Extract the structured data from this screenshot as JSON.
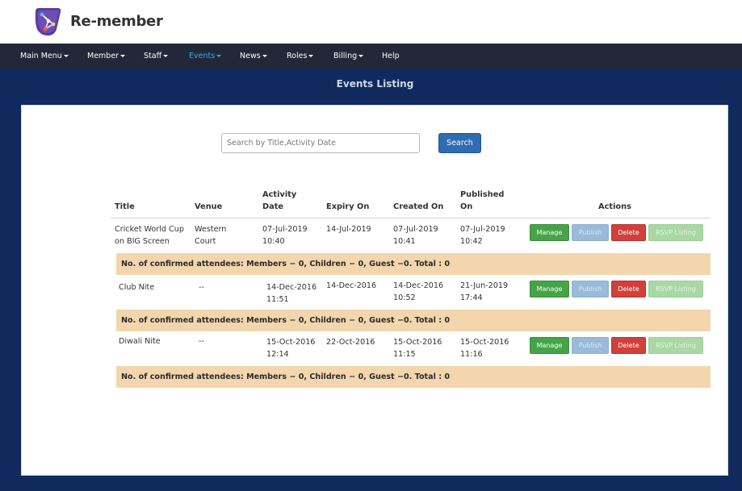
{
  "app": {
    "name": "Re-member",
    "logo_icon": "app-logo-icon"
  },
  "nav": {
    "items": [
      {
        "label": "Main Menu",
        "dropdown": true
      },
      {
        "label": "Member",
        "dropdown": true
      },
      {
        "label": "Staff",
        "dropdown": true
      },
      {
        "label": "Events",
        "dropdown": true,
        "active": true
      },
      {
        "label": "News",
        "dropdown": true
      },
      {
        "label": "Roles",
        "dropdown": true
      },
      {
        "label": "Billing",
        "dropdown": true
      },
      {
        "label": "Help",
        "dropdown": false
      }
    ]
  },
  "page": {
    "title": "Events Listing"
  },
  "search": {
    "placeholder": "Search by Title,Activity Date",
    "value": "",
    "button_label": "Search"
  },
  "table": {
    "headers": {
      "title": "Title",
      "venue": "Venue",
      "activity_date_l1": "Activity",
      "activity_date_l2": "Date",
      "expiry_on": "Expiry On",
      "created_on": "Created On",
      "published_on_l1": "Published",
      "published_on_l2": "On",
      "actions": "Actions"
    },
    "rows": [
      {
        "title_l1": "Cricket World Cup",
        "title_l2": "on BIG Screen",
        "venue_l1": "Western",
        "venue_l2": "Court",
        "activity_date_l1": "07-Jul-2019",
        "activity_date_l2": "10:40",
        "expiry_on": "14-Jul-2019",
        "created_on_l1": "07-Jul-2019",
        "created_on_l2": "10:41",
        "published_on_l1": "07-Jul-2019",
        "published_on_l2": "10:42",
        "summary": "No. of confirmed attendees: Members − 0, Children − 0, Guest −0. Total : 0"
      },
      {
        "title_l1": "Club Nite",
        "title_l2": "",
        "venue_l1": "--",
        "venue_l2": "",
        "activity_date_l1": "14-Dec-2016",
        "activity_date_l2": "11:51",
        "expiry_on": "14-Dec-2016",
        "created_on_l1": "14-Dec-2016",
        "created_on_l2": "10:52",
        "published_on_l1": "21-Jun-2019",
        "published_on_l2": "17:44",
        "summary": "No. of confirmed attendees: Members − 0, Children − 0, Guest −0. Total : 0"
      },
      {
        "title_l1": "Diwali Nite",
        "title_l2": "",
        "venue_l1": "--",
        "venue_l2": "",
        "activity_date_l1": "15-Oct-2016",
        "activity_date_l2": "12:14",
        "expiry_on": "22-Oct-2016",
        "created_on_l1": "15-Oct-2016",
        "created_on_l2": "11:15",
        "published_on_l1": "15-Oct-2016",
        "published_on_l2": "11:16",
        "summary": "No. of confirmed attendees: Members − 0, Children − 0, Guest −0. Total : 0"
      }
    ],
    "action_labels": {
      "manage": "Manage",
      "publish": "Publish",
      "delete": "Delete",
      "rsvp": "RSVP Listing"
    }
  },
  "colors": {
    "navbar": "#222838",
    "nav_active": "#27b6e8",
    "page_bg": "#102a5d",
    "summary_bg": "#f3d6ae",
    "manage": "#47a348",
    "publish_disabled": "#99bbd9",
    "delete": "#d1403a",
    "rsvp_disabled": "#a9d8a4",
    "search_button": "#2f6db3"
  }
}
